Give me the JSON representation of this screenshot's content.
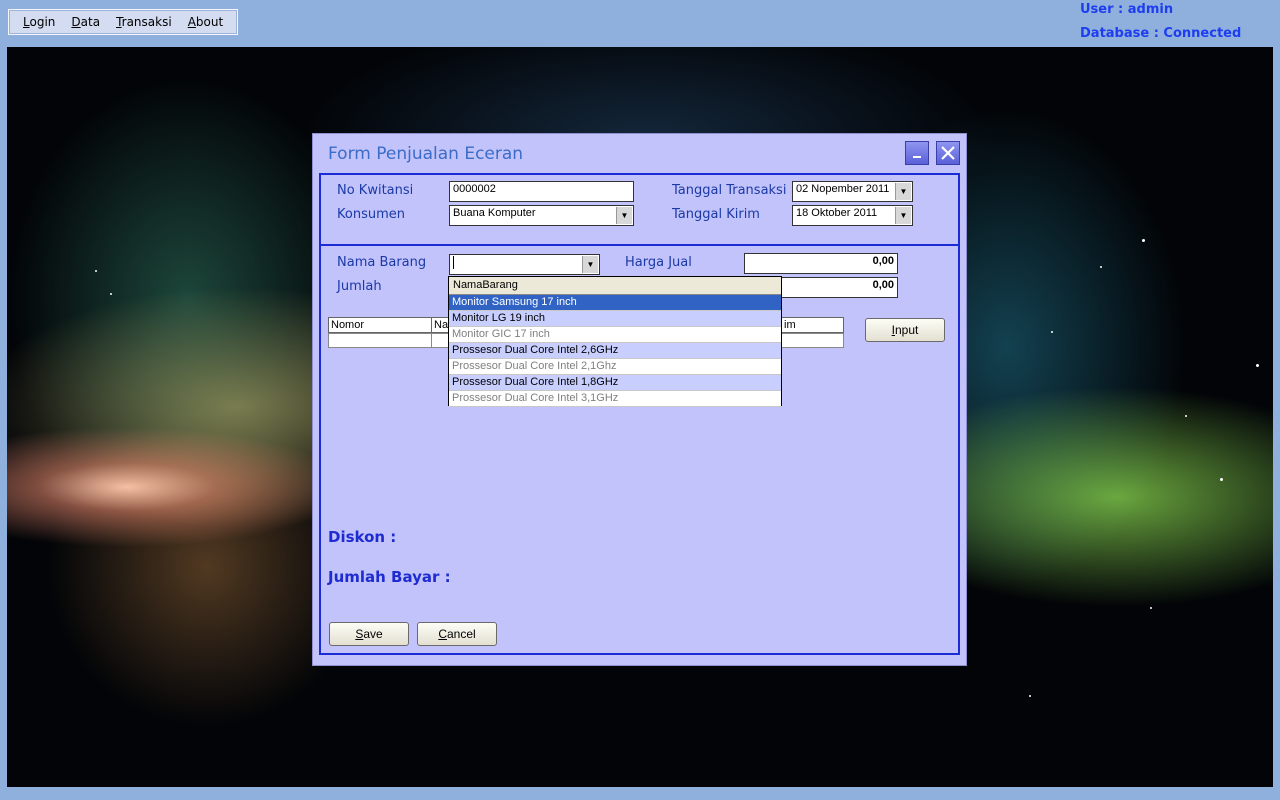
{
  "menu": {
    "items": [
      {
        "pre": "",
        "key": "L",
        "post": "ogin"
      },
      {
        "pre": "",
        "key": "D",
        "post": "ata"
      },
      {
        "pre": "",
        "key": "T",
        "post": "ransaksi"
      },
      {
        "pre": "",
        "key": "A",
        "post": "bout"
      }
    ]
  },
  "status": {
    "user": "User : admin",
    "database": "Database : Connected"
  },
  "dialog": {
    "title": "Form Penjualan Eceran",
    "minimize_icon": "minimize-icon",
    "close_icon": "close-icon",
    "no_kwitansi_label": "No Kwitansi",
    "no_kwitansi_value": "0000002",
    "konsumen_label": "Konsumen",
    "konsumen_value": "Buana Komputer",
    "tanggal_transaksi_label": "Tanggal Transaksi",
    "tanggal_transaksi_value": "02 Nopember 2011",
    "tanggal_kirim_label": "Tanggal Kirim",
    "tanggal_kirim_value": "18 Oktober 2011",
    "nama_barang_label": "Nama Barang",
    "nama_barang_value": "",
    "jumlah_label": "Jumlah",
    "harga_jual_label": "Harga Jual",
    "harga_jual_value": "0,00",
    "total_value": "0,00",
    "grid_headers": [
      "Nomor",
      "Na",
      "im"
    ],
    "input_button": {
      "key": "I",
      "rest": "nput"
    },
    "diskon_label": "Diskon :",
    "jumlah_bayar_label": "Jumlah Bayar :",
    "save_button": {
      "key": "S",
      "rest": "ave"
    },
    "cancel_button": {
      "key": "C",
      "rest": "ancel"
    }
  },
  "dropdown": {
    "header": "NamaBarang",
    "items": [
      {
        "label": "Monitor Samsung 17 inch",
        "state": "selected"
      },
      {
        "label": "Monitor LG 19 inch",
        "state": "alt"
      },
      {
        "label": "Monitor GIC 17 inch",
        "state": "dim"
      },
      {
        "label": "Prossesor Dual Core Intel 2,6GHz",
        "state": "alt"
      },
      {
        "label": "Prossesor Dual Core Intel 2,1Ghz",
        "state": "dim"
      },
      {
        "label": "Prossesor Dual Core Intel 1,8GHz",
        "state": "alt"
      },
      {
        "label": "Prossesor Dual Core Intel 3,1GHz",
        "state": "dim"
      }
    ]
  },
  "colors": {
    "dialog_bg": "#c2c3fb",
    "panel_border": "#1b2bd6",
    "selected_row": "#3163c4",
    "status_text": "#1e3df0"
  }
}
